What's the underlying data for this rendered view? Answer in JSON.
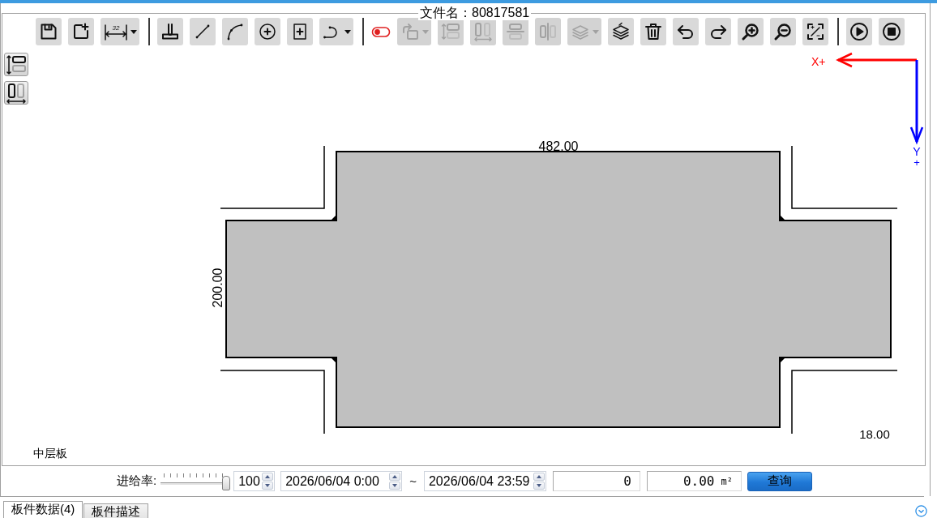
{
  "window": {
    "file_label": "文件名：80817581"
  },
  "toolbar": {
    "groups": [
      {
        "tools": [
          {
            "kind": "button",
            "disabled": false
          },
          {
            "kind": "button",
            "disabled": false
          },
          {
            "kind": "dropdown",
            "disabled": false,
            "caption": "32"
          }
        ]
      },
      {
        "tools": [
          {
            "kind": "button",
            "disabled": false
          },
          {
            "kind": "button",
            "disabled": false
          },
          {
            "kind": "button",
            "disabled": false
          },
          {
            "kind": "button",
            "disabled": false
          },
          {
            "kind": "button",
            "disabled": false
          },
          {
            "kind": "dropdown",
            "disabled": false
          }
        ]
      },
      {
        "tools": [
          {
            "kind": "toggle",
            "disabled": false
          },
          {
            "kind": "dropdown",
            "disabled": true
          },
          {
            "kind": "button",
            "disabled": true
          },
          {
            "kind": "button",
            "disabled": true
          },
          {
            "kind": "button",
            "disabled": true
          },
          {
            "kind": "button",
            "disabled": true
          },
          {
            "kind": "dropdown",
            "disabled": true
          },
          {
            "kind": "button",
            "disabled": false
          },
          {
            "kind": "button",
            "disabled": false
          },
          {
            "kind": "button",
            "disabled": false
          },
          {
            "kind": "button",
            "disabled": false
          },
          {
            "kind": "button",
            "disabled": false
          },
          {
            "kind": "button",
            "disabled": false
          },
          {
            "kind": "button",
            "disabled": false
          }
        ]
      },
      {
        "tools": [
          {
            "kind": "button",
            "disabled": false
          },
          {
            "kind": "button",
            "disabled": false
          }
        ]
      }
    ]
  },
  "side_tools": [
    {
      "disabled": false
    },
    {
      "disabled": false
    }
  ],
  "canvas": {
    "top_dimension": "482.00",
    "side_dimension": "200.00",
    "thickness": "18.00",
    "layer_name": "中层板",
    "x_axis_label": "X+",
    "y_axis_label": "Y",
    "y_axis_sign": "+"
  },
  "controls": {
    "feed_rate_label": "进给率:",
    "feed_rate": {
      "level": 1,
      "value": "100"
    },
    "date_from": "2026/06/04 0:00",
    "range_separator": "~",
    "date_to": "2026/06/04 23:59",
    "count": "0",
    "area": {
      "value": "0.00",
      "unit": "m²"
    },
    "query_button": "查询"
  },
  "tabs": [
    {
      "label": "板件数据(4)",
      "selected": true
    },
    {
      "label": "板件描述",
      "selected": false
    }
  ]
}
